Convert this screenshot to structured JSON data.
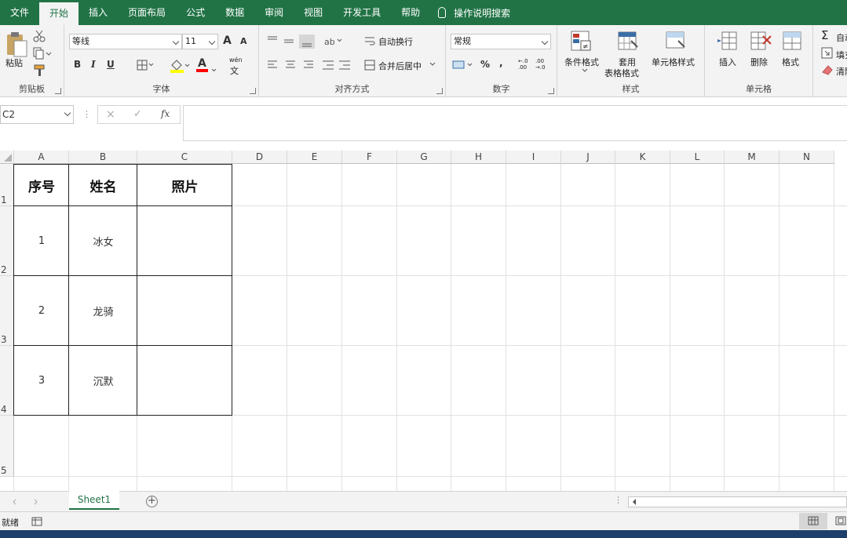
{
  "tabs": [
    "文件",
    "开始",
    "插入",
    "页面布局",
    "公式",
    "数据",
    "审阅",
    "视图",
    "开发工具",
    "帮助"
  ],
  "active_tab": "开始",
  "tell_me": "操作说明搜索",
  "clipboard": {
    "paste": "粘贴",
    "label": "剪贴板"
  },
  "font": {
    "name": "等线",
    "size": "11",
    "label": "字体",
    "bold": "B",
    "italic": "I",
    "underline": "U",
    "grow": "A",
    "shrink": "A",
    "font_color_letter": "A",
    "phonetic_top": "wén",
    "phonetic_char": "文"
  },
  "alignment": {
    "wrap": "自动换行",
    "merge": "合并后居中",
    "label": "对齐方式"
  },
  "number": {
    "format": "常规",
    "percent": "%",
    "comma": ",",
    "inc": "←.0\n.00",
    "dec": ".00\n→.0",
    "label": "数字"
  },
  "styles": {
    "conditional": "条件格式",
    "table_format_1": "套用",
    "table_format_2": "表格格式",
    "cell_styles": "单元格样式",
    "label": "样式"
  },
  "cells": {
    "insert": "插入",
    "delete": "删除",
    "format": "格式",
    "label": "单元格"
  },
  "editing": {
    "autosum": "自动",
    "fill": "填充",
    "clear": "清除"
  },
  "formula_bar": {
    "name_box": "C2",
    "cancel": "×",
    "enter": "✓",
    "fx": "fx"
  },
  "columns": [
    "A",
    "B",
    "C",
    "D",
    "E",
    "F",
    "G",
    "H",
    "I",
    "J",
    "K",
    "L",
    "M",
    "N"
  ],
  "rows": [
    "1",
    "2",
    "3",
    "4",
    "5"
  ],
  "table": {
    "headers": [
      "序号",
      "姓名",
      "照片"
    ],
    "rows": [
      {
        "num": "1",
        "name": "冰女"
      },
      {
        "num": "2",
        "name": "龙骑"
      },
      {
        "num": "3",
        "name": "沉默"
      }
    ]
  },
  "sheet": {
    "name": "Sheet1",
    "add": "+"
  },
  "status": {
    "ready": "就绪"
  },
  "colors": {
    "accent": "#217346",
    "ribbon_bg": "#f3f3f3",
    "highlight": "#ffff00",
    "font_red": "#ff0000"
  }
}
